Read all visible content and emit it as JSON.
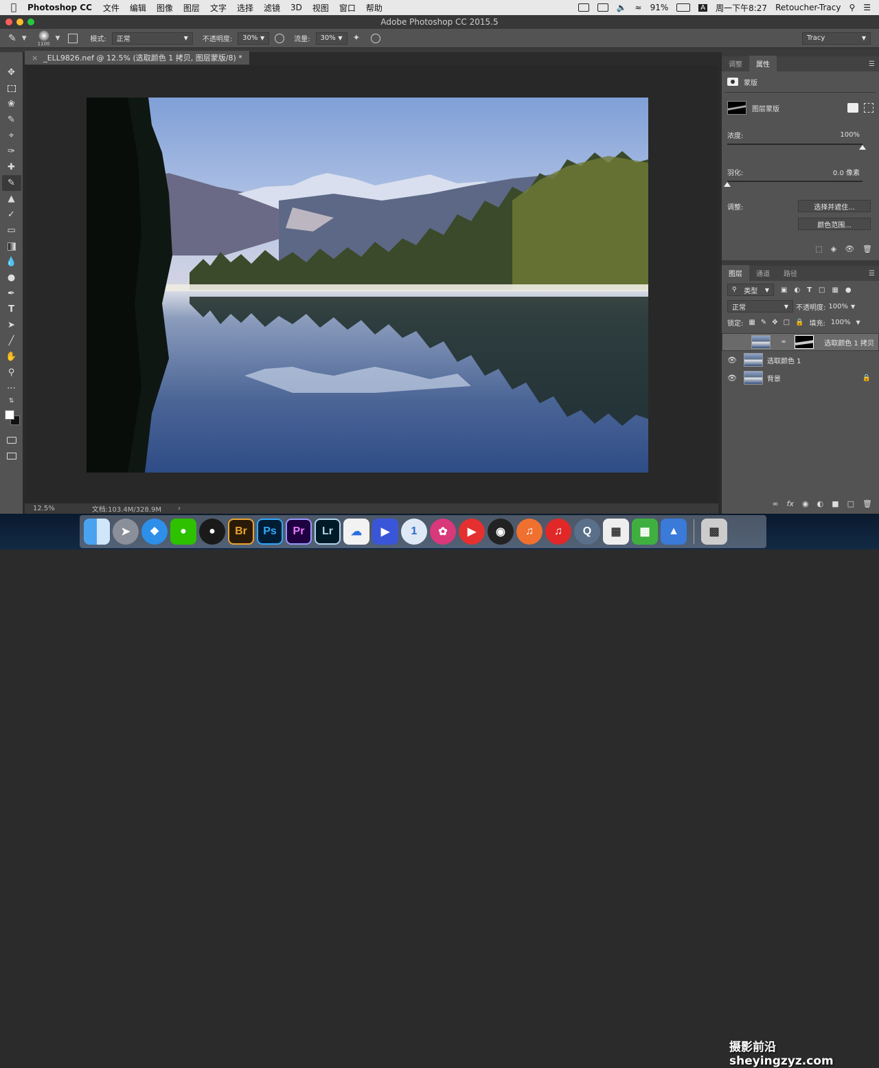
{
  "menubar": {
    "app": "Photoshop CC",
    "items": [
      "文件",
      "编辑",
      "图像",
      "图层",
      "文字",
      "选择",
      "滤镜",
      "3D",
      "视图",
      "窗口",
      "帮助"
    ],
    "battery": "91%",
    "input_method": "A",
    "clock": "周一下午8:27",
    "user": "Retoucher-Tracy"
  },
  "window": {
    "title": "Adobe Photoshop CC 2015.5"
  },
  "options": {
    "brush_size": "1100",
    "mode_label": "模式:",
    "mode_value": "正常",
    "opacity_label": "不透明度:",
    "opacity_value": "30%",
    "flow_label": "流量:",
    "flow_value": "30%",
    "workspace": "Tracy"
  },
  "document": {
    "tab_title": "_ELL9826.nef @ 12.5% (选取颜色 1 拷贝, 图层蒙版/8) *",
    "zoom": "12.5%",
    "doc_info": "文档:103.4M/328.9M"
  },
  "properties": {
    "tabs": [
      "调整",
      "属性"
    ],
    "section": "蒙版",
    "mask_label": "图层蒙版",
    "density_label": "浓度:",
    "density_value": "100%",
    "density_level": 1.0,
    "feather_label": "羽化:",
    "feather_value": "0.0 像素",
    "feather_level": 0.0,
    "adjust_label": "调整:",
    "btn_select_mask": "选择并遮住...",
    "btn_color_range": "颜色范围..."
  },
  "layers_panel": {
    "tabs": [
      "图层",
      "通道",
      "路径"
    ],
    "filter_label": "类型",
    "blend_mode": "正常",
    "opacity_label": "不透明度:",
    "opacity_value": "100%",
    "lock_label": "锁定:",
    "fill_label": "填充:",
    "fill_value": "100%",
    "layers": [
      {
        "name": "选取颜色 1 拷贝",
        "visible": false,
        "selected": true
      },
      {
        "name": "选取颜色 1",
        "visible": true,
        "selected": false
      },
      {
        "name": "背景",
        "visible": true,
        "selected": false
      }
    ]
  },
  "dock": {
    "labels": [
      "Br",
      "Ps",
      "Pr",
      "Lr"
    ]
  },
  "watermark": "摄影前沿 sheyingzyz.com",
  "colors": {
    "panel": "#535353",
    "canvas_bg": "#282828",
    "menubar": "#e8e8e8"
  }
}
